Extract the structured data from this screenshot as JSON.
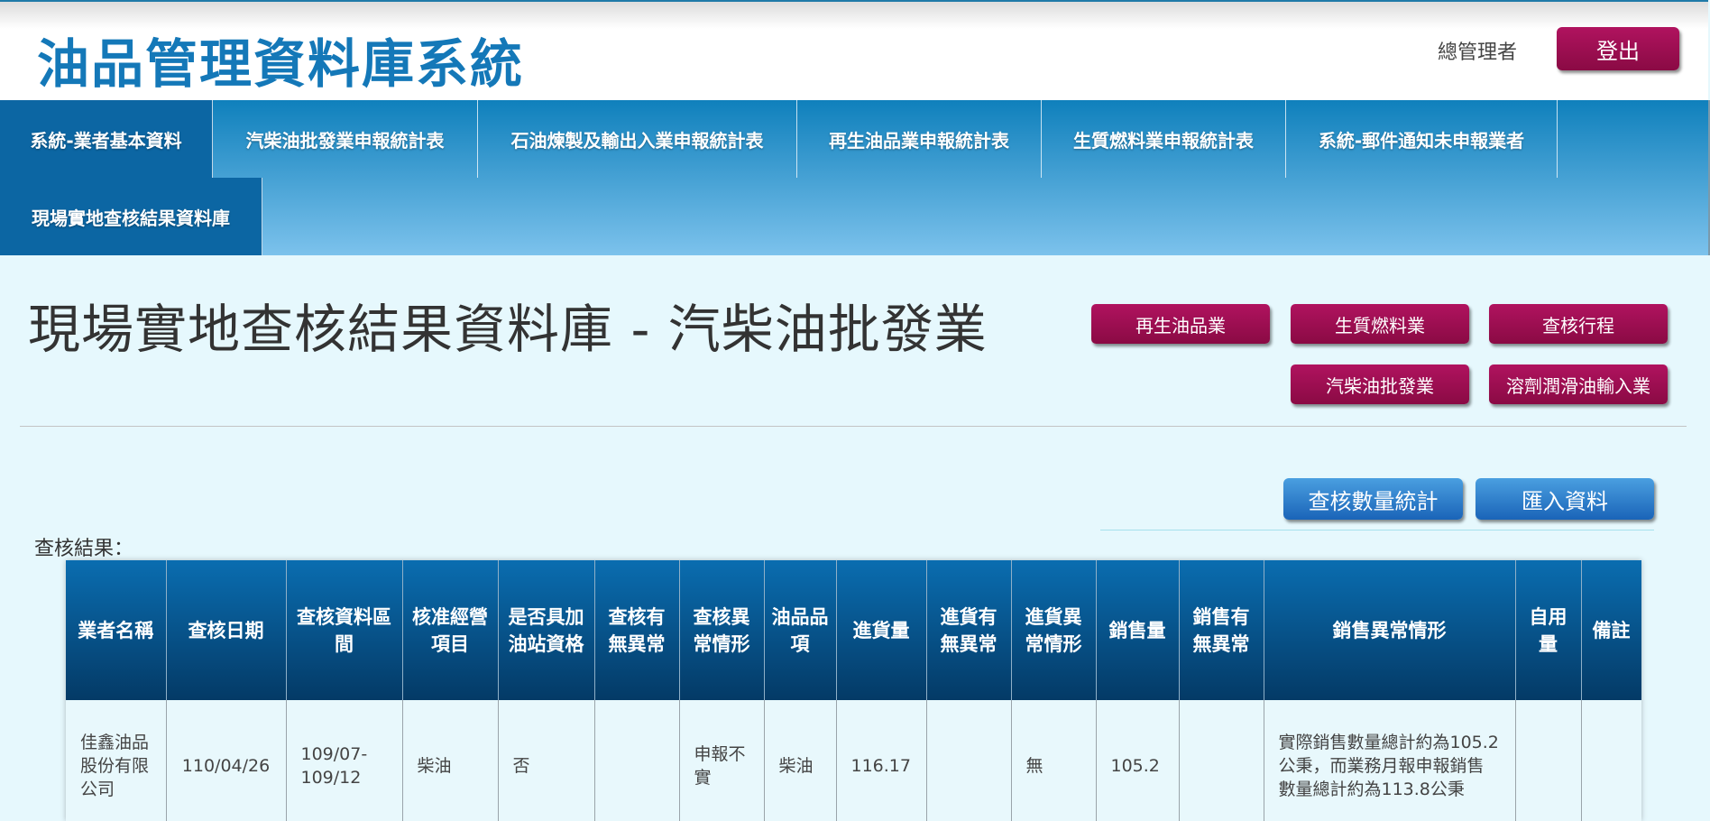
{
  "header": {
    "app_title": "油品管理資料庫系統",
    "user_name": "總管理者",
    "logout_label": "登出"
  },
  "nav": {
    "items": [
      {
        "label": "系統-業者基本資料",
        "active": true
      },
      {
        "label": "汽柴油批發業申報統計表",
        "active": false
      },
      {
        "label": "石油煉製及輸出入業申報統計表",
        "active": false
      },
      {
        "label": "再生油品業申報統計表",
        "active": false
      },
      {
        "label": "生質燃料業申報統計表",
        "active": false
      },
      {
        "label": "系統-郵件通知未申報業者",
        "active": false
      },
      {
        "label": "現場實地查核結果資料庫",
        "active": true
      }
    ]
  },
  "page": {
    "title": "現場實地查核結果資料庫 - 汽柴油批發業",
    "category_buttons": [
      "再生油品業",
      "生質燃料業",
      "查核行程",
      "汽柴油批發業",
      "溶劑潤滑油輸入業"
    ],
    "stats_button": "查核數量統計",
    "import_button": "匯入資料",
    "result_label": "查核結果："
  },
  "table": {
    "headers": [
      "業者名稱",
      "查核日期",
      "查核資料區間",
      "核准經營項目",
      "是否具加油站資格",
      "查核有無異常",
      "查核異常情形",
      "油品品項",
      "進貨量",
      "進貨有無異常",
      "進貨異常情形",
      "銷售量",
      "銷售有無異常",
      "銷售異常情形",
      "自用量",
      "備註"
    ],
    "rows": [
      [
        "佳鑫油品股份有限公司",
        "110/04/26",
        "109/07-109/12",
        "柴油",
        "否",
        "",
        "申報不實",
        "柴油",
        "116.17",
        "",
        "無",
        "105.2",
        "",
        "實際銷售數量總計約為105.2公秉，而業務月報申報銷售數量總計約為113.8公秉",
        "",
        ""
      ]
    ]
  },
  "colors": {
    "brand_blue": "#1478b8",
    "nav_active": "#0c66a3",
    "magenta_button": "#9c0f52",
    "blue_button": "#2a7bcc",
    "table_header": "#064f87",
    "page_background": "#e6f8fd"
  }
}
